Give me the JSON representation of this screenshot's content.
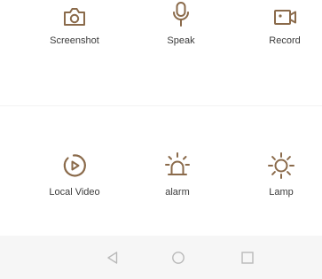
{
  "controls": {
    "row1": [
      {
        "label": "Screenshot",
        "icon": "camera-icon"
      },
      {
        "label": "Speak",
        "icon": "microphone-icon"
      },
      {
        "label": "Record",
        "icon": "video-camera-icon"
      }
    ],
    "row2": [
      {
        "label": "Local Video",
        "icon": "play-circle-icon"
      },
      {
        "label": "alarm",
        "icon": "siren-icon"
      },
      {
        "label": "Lamp",
        "icon": "sun-icon"
      }
    ]
  },
  "navbar": {
    "back_icon": "back-triangle-icon",
    "home_icon": "home-circle-icon",
    "recents_icon": "recents-square-icon"
  },
  "colors": {
    "accent": "#8a6a4a",
    "nav_icon": "#b9b9b9",
    "navbar_bg": "#f6f6f6"
  }
}
